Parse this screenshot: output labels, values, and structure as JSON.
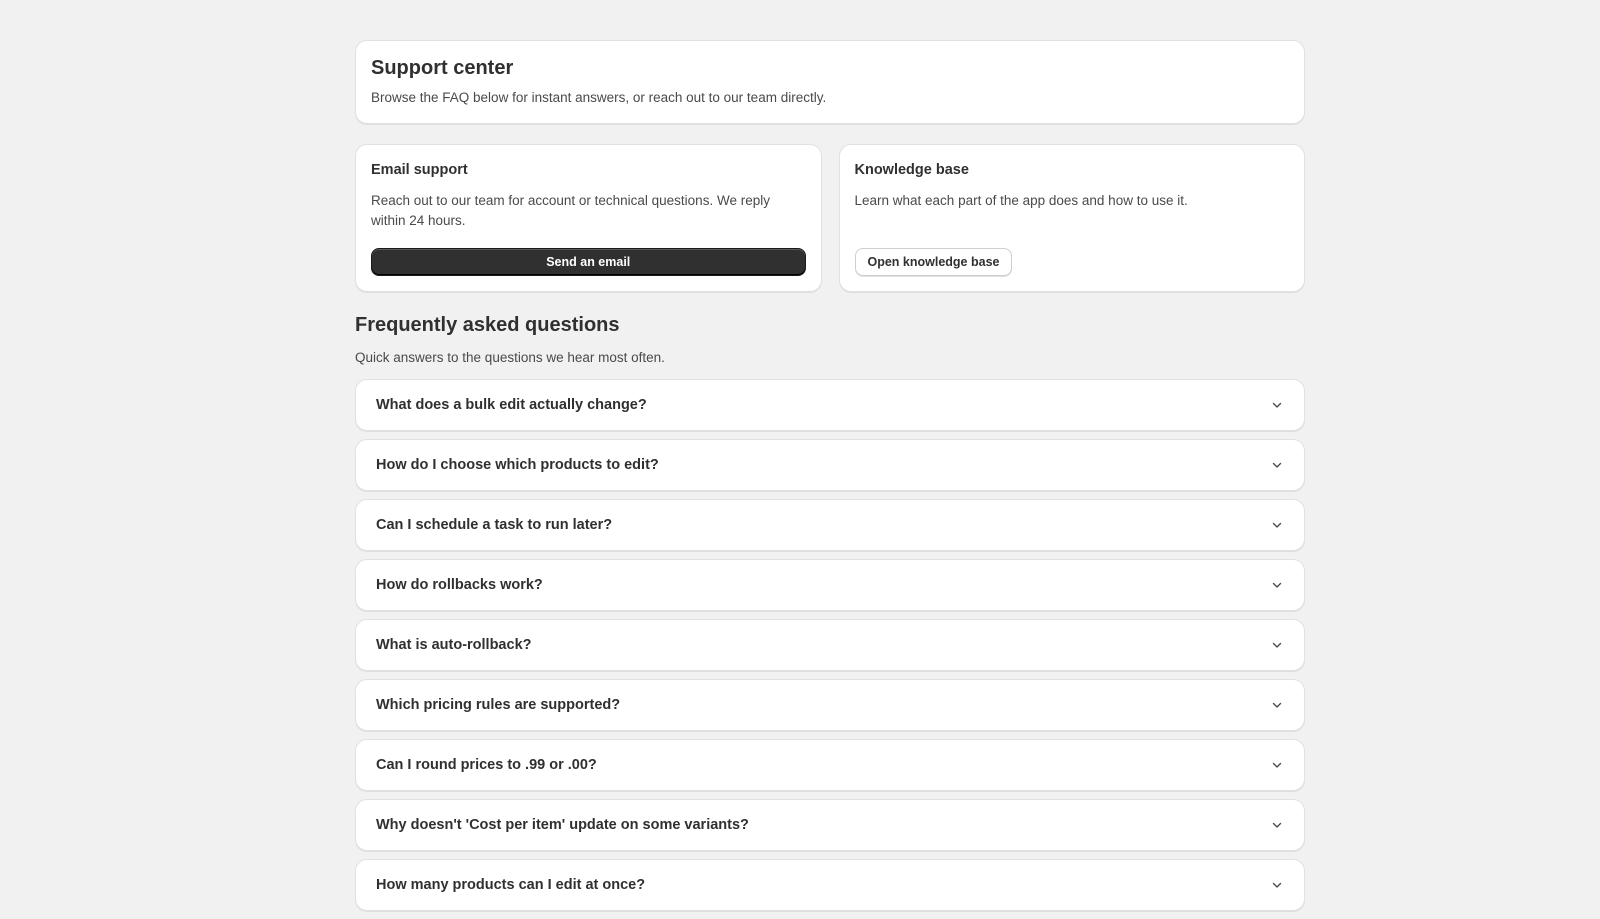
{
  "header": {
    "title": "Support center",
    "subtitle": "Browse the FAQ below for instant answers, or reach out to our team directly."
  },
  "email_support": {
    "title": "Email support",
    "text": "Reach out to our team for account or technical questions. We reply within 24 hours.",
    "button_label": "Send an email"
  },
  "knowledge_base": {
    "title": "Knowledge base",
    "text": "Learn what each part of the app does and how to use it.",
    "button_label": "Open knowledge base"
  },
  "faq": {
    "title": "Frequently asked questions",
    "subtitle": "Quick answers to the questions we hear most often.",
    "items": [
      "What does a bulk edit actually change?",
      "How do I choose which products to edit?",
      "Can I schedule a task to run later?",
      "How do rollbacks work?",
      "What is auto-rollback?",
      "Which pricing rules are supported?",
      "Can I round prices to .99 or .00?",
      "Why doesn't 'Cost per item' update on some variants?",
      "How many products can I edit at once?"
    ]
  },
  "colors": {
    "background": "#f1f1f1",
    "card": "#ffffff",
    "primary_button": "#303030",
    "text": "#303030"
  }
}
